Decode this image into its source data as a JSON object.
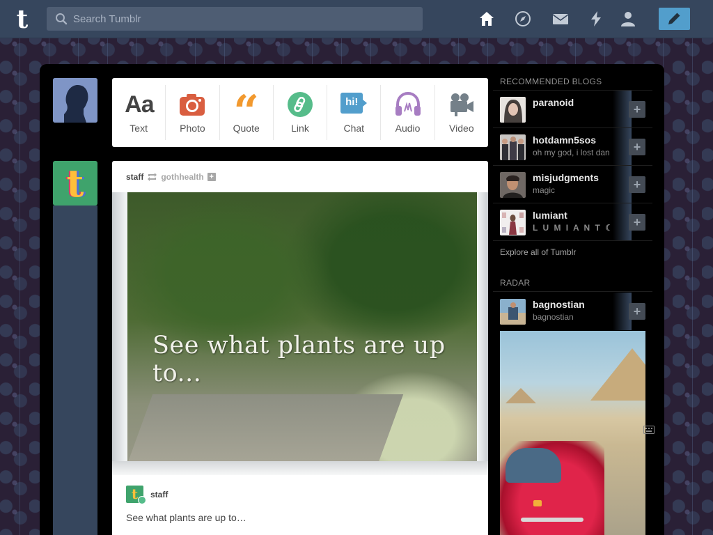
{
  "app": {
    "logo": "t"
  },
  "search": {
    "placeholder": "Search Tumblr",
    "icon": "search-icon"
  },
  "nav": {
    "items": [
      {
        "name": "home",
        "icon": "home-icon"
      },
      {
        "name": "explore",
        "icon": "compass-icon"
      },
      {
        "name": "inbox",
        "icon": "mail-icon"
      },
      {
        "name": "activity",
        "icon": "lightning-icon"
      },
      {
        "name": "account",
        "icon": "person-icon"
      }
    ],
    "compose": {
      "icon": "pencil-icon",
      "color": "#529ecc"
    }
  },
  "post_types": [
    {
      "label": "Text",
      "icon": "text-icon",
      "glyph": "Aa",
      "color": "#444444"
    },
    {
      "label": "Photo",
      "icon": "camera-icon",
      "color": "#d95e40"
    },
    {
      "label": "Quote",
      "icon": "quote-icon",
      "glyph": "“",
      "color": "#f2992e"
    },
    {
      "label": "Link",
      "icon": "link-icon",
      "color": "#56bc8a"
    },
    {
      "label": "Chat",
      "icon": "chat-icon",
      "glyph": "hi!",
      "color": "#529ecc"
    },
    {
      "label": "Audio",
      "icon": "headphones-icon",
      "color": "#a77dc2"
    },
    {
      "label": "Video",
      "icon": "video-camera-icon",
      "color": "#748089"
    }
  ],
  "post": {
    "author": "staff",
    "reblogged_from": "gothhealth",
    "image_text": "See what plants are up to...",
    "footer_author": "staff",
    "caption": "See what plants are up to…"
  },
  "sidebar": {
    "recommended_heading": "RECOMMENDED BLOGS",
    "recommended": [
      {
        "name": "paranoid",
        "desc": ""
      },
      {
        "name": "hotdamn5sos",
        "desc": "oh my god, i lost dan"
      },
      {
        "name": "misjudgments",
        "desc": "magic"
      },
      {
        "name": "lumiant",
        "desc": "L U M I A N T ☾"
      }
    ],
    "explore_label": "Explore all of Tumblr",
    "radar_heading": "RADAR",
    "radar": {
      "name": "bagnostian",
      "desc": "bagnostian"
    },
    "follow_glyph": "+"
  },
  "colors": {
    "topbar": "#36465d",
    "search_bg": "#4e5d73",
    "accent": "#529ecc",
    "background": "#2a2036"
  }
}
